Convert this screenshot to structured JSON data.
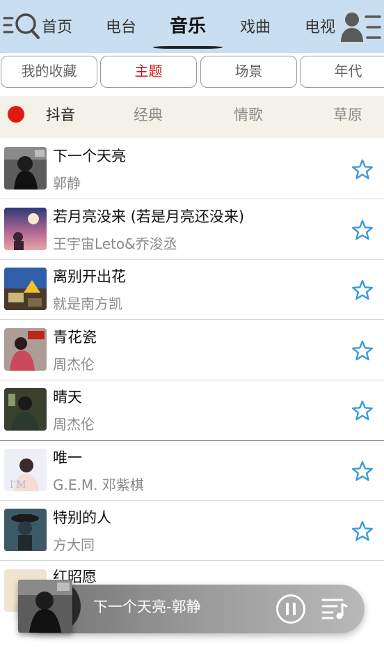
{
  "colors": {
    "topbar_bg": "#c9def0",
    "accent_red": "#d11a1a",
    "star_blue": "#3d9ad8",
    "tag_row_bg": "#f3f1e8"
  },
  "top_nav": {
    "search_icon": "search-icon",
    "profile_icon": "user-menu-icon",
    "tabs": [
      {
        "label": "首页",
        "active": false
      },
      {
        "label": "电台",
        "active": false
      },
      {
        "label": "音乐",
        "active": true
      },
      {
        "label": "戏曲",
        "active": false
      },
      {
        "label": "电视",
        "active": false
      }
    ]
  },
  "category_pills": [
    {
      "label": "我的收藏",
      "active": false
    },
    {
      "label": "主题",
      "active": true
    },
    {
      "label": "场景",
      "active": false
    },
    {
      "label": "年代",
      "active": false
    }
  ],
  "sub_tags": [
    {
      "label": "抖音",
      "active": true
    },
    {
      "label": "经典",
      "active": false
    },
    {
      "label": "情歌",
      "active": false
    },
    {
      "label": "草原",
      "active": false
    }
  ],
  "songs": [
    {
      "title": "下一个天亮",
      "artist": "郭静"
    },
    {
      "title": "若月亮没来 (若是月亮还没来)",
      "artist": "王宇宙Leto&乔浚丞"
    },
    {
      "title": "离别开出花",
      "artist": "就是南方凯"
    },
    {
      "title": "青花瓷",
      "artist": "周杰伦"
    },
    {
      "title": "晴天",
      "artist": "周杰伦"
    },
    {
      "title": "唯一",
      "artist": "G.E.M. 邓紫棋"
    },
    {
      "title": "特别的人",
      "artist": "方大同"
    },
    {
      "title": "红昭愿",
      "artist": ""
    }
  ],
  "player": {
    "now_playing": "下一个天亮-郭静",
    "state": "playing"
  }
}
